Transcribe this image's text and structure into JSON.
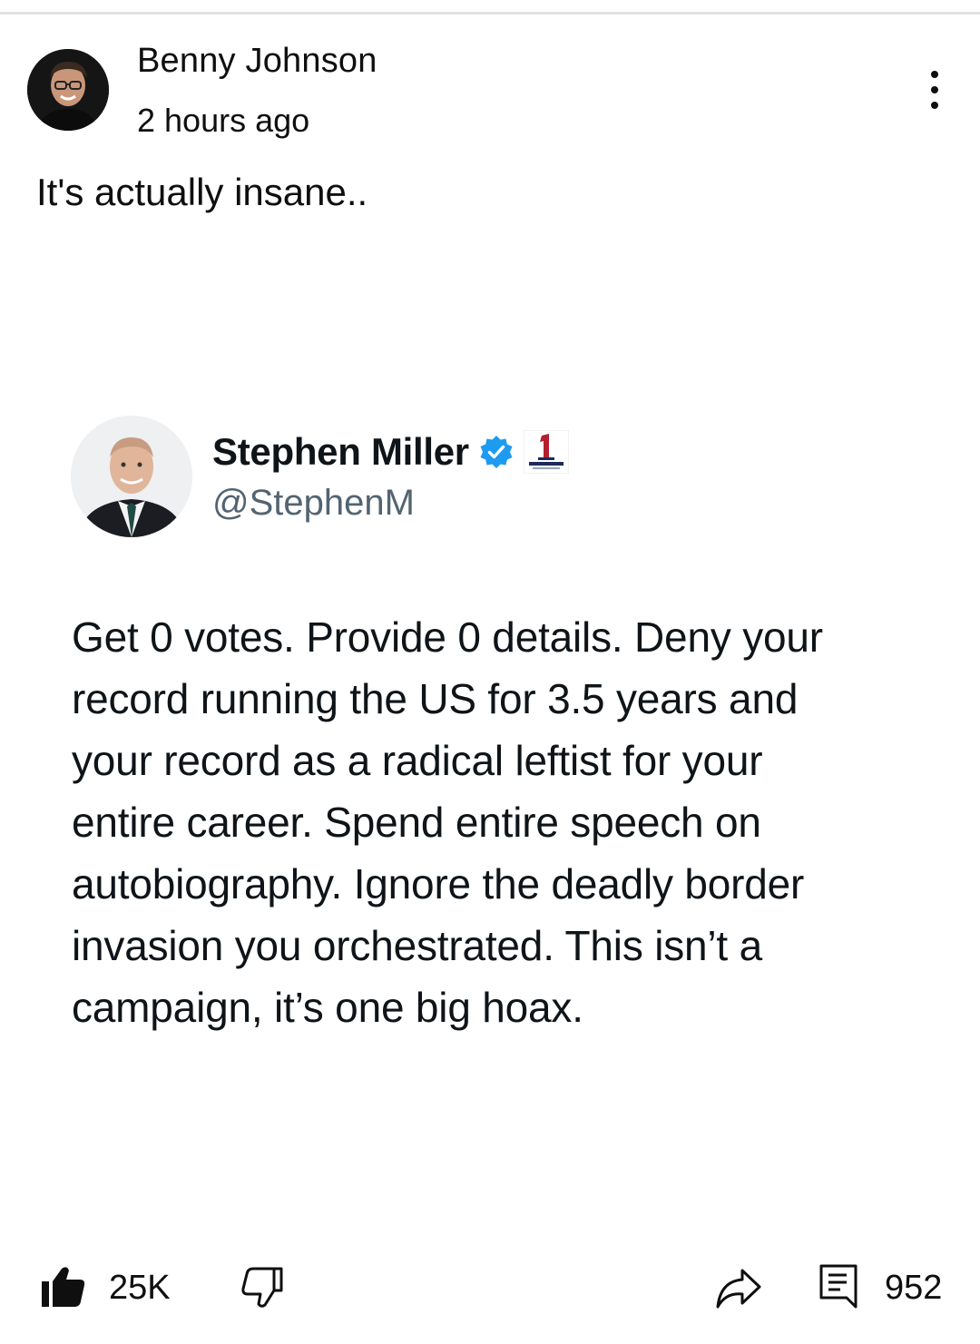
{
  "post": {
    "author_name": "Benny Johnson",
    "timestamp": "2 hours ago",
    "text": "It's actually insane..",
    "avatar_icon": "user-avatar",
    "more_icon": "more-vert-icon"
  },
  "tweet": {
    "name": "Stephen Miller",
    "handle": "@StephenM",
    "verified_icon": "verified-badge-icon",
    "verified_color": "#1d9bf0",
    "badge_text": "AMERICA FIRST",
    "body_lines": [
      "Get 0 votes. Provide 0 details. Deny your",
      "record running the US for 3.5 years and",
      "your record as a radical leftist for your",
      "entire career. Spend entire speech on",
      "autobiography. Ignore the deadly border",
      "invasion you orchestrated. This isn’t a",
      "campaign, it’s one big hoax."
    ]
  },
  "actions": {
    "like_count": "25K",
    "comment_count": "952",
    "like_icon": "thumbs-up-icon",
    "dislike_icon": "thumbs-down-icon",
    "share_icon": "share-icon",
    "comment_icon": "comment-icon"
  }
}
